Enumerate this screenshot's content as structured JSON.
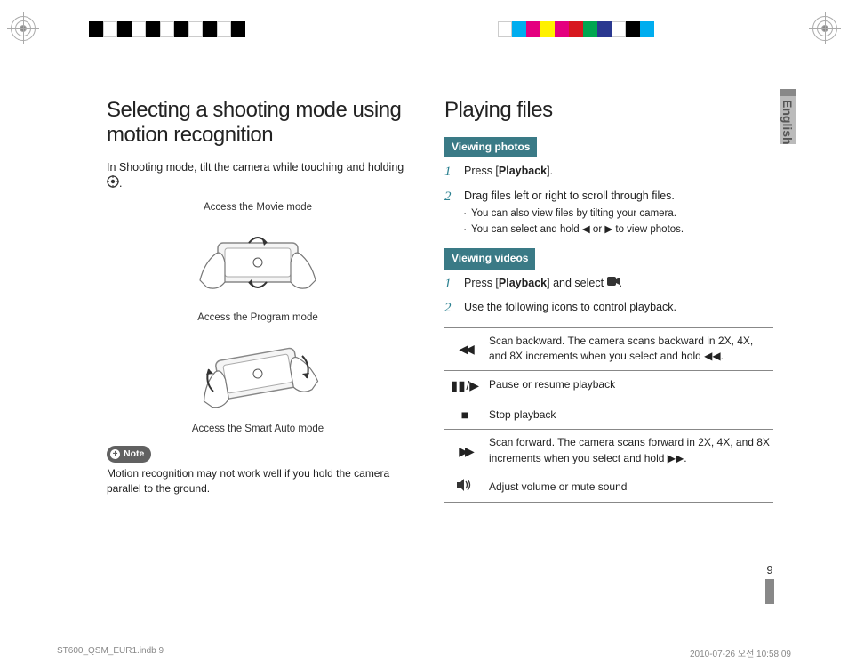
{
  "left": {
    "heading": "Selecting a shooting mode using motion recognition",
    "intro_pre": "In Shooting mode, tilt the camera while touching and holding ",
    "intro_post": ".",
    "caption1": "Access the Movie mode",
    "caption2": "Access the Program mode",
    "caption3": "Access the Smart Auto mode",
    "note_label": "Note",
    "note_text": "Motion recognition may not work well if you hold the camera parallel to the ground."
  },
  "right": {
    "heading": "Playing files",
    "section_photos": "Viewing photos",
    "photos_steps": [
      {
        "pre": "Press [",
        "bold": "Playback",
        "post": "]."
      },
      {
        "text": "Drag files left or right to scroll through files.",
        "bullets": [
          "You can also view files by tilting your camera.",
          "You can select and hold ◀ or ▶ to view photos."
        ]
      }
    ],
    "section_videos": "Viewing videos",
    "videos_steps": [
      {
        "pre": "Press [",
        "bold": "Playback",
        "post_pre": "] and select ",
        "post": "."
      },
      {
        "text": "Use the following icons to control playback."
      }
    ],
    "table": [
      {
        "icon": "rewind",
        "desc": "Scan backward. The camera scans backward in 2X, 4X, and 8X increments when you select and hold ◀◀."
      },
      {
        "icon": "pause",
        "desc": "Pause or resume playback"
      },
      {
        "icon": "stop",
        "desc": "Stop playback"
      },
      {
        "icon": "forward",
        "desc": "Scan forward. The camera scans forward in 2X, 4X, and 8X increments when you select and hold ▶▶."
      },
      {
        "icon": "volume",
        "desc": "Adjust volume or mute sound"
      }
    ]
  },
  "side_label": "English",
  "page_number": "9",
  "footer_left": "ST600_QSM_EUR1.indb   9",
  "footer_right": "2010-07-26   오전 10:58:09"
}
